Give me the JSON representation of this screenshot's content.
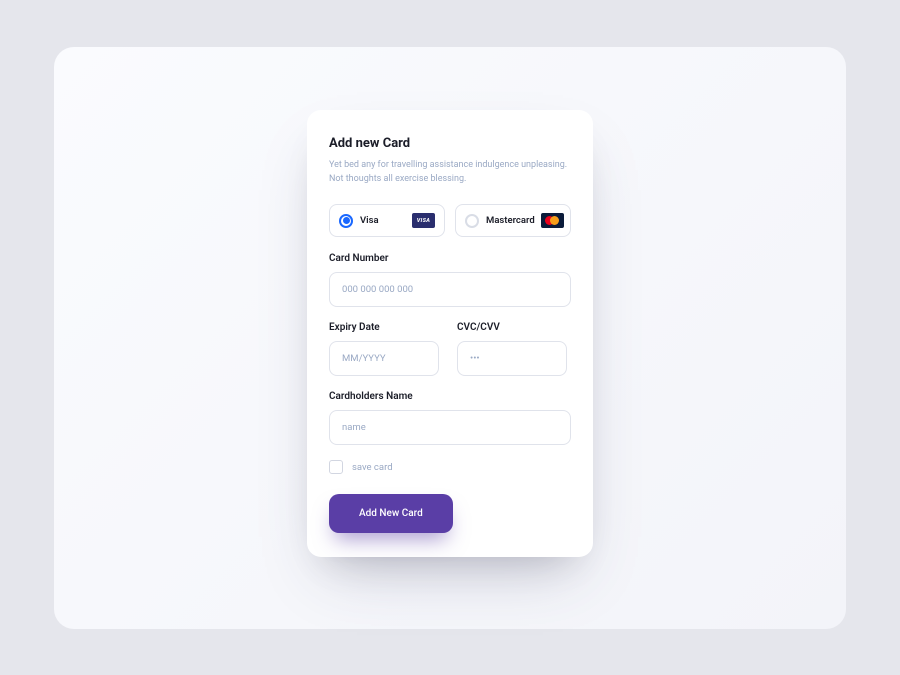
{
  "header": {
    "title": "Add new Card",
    "subtitle": "Yet bed any for travelling assistance indulgence unpleasing. Not thoughts all exercise blessing."
  },
  "card_type": {
    "options": [
      {
        "label": "Visa",
        "selected": true,
        "badge_text": "VISA"
      },
      {
        "label": "Mastercard",
        "selected": false
      }
    ]
  },
  "fields": {
    "card_number": {
      "label": "Card Number",
      "placeholder": "000 000 000 000"
    },
    "expiry": {
      "label": "Expiry Date",
      "placeholder": "MM/YYYY"
    },
    "cvc": {
      "label": "CVC/CVV",
      "placeholder": "•••"
    },
    "cardholder": {
      "label": "Cardholders Name",
      "placeholder": "name"
    }
  },
  "save_card": {
    "label": "save card",
    "checked": false
  },
  "submit": {
    "label": "Add New Card"
  }
}
